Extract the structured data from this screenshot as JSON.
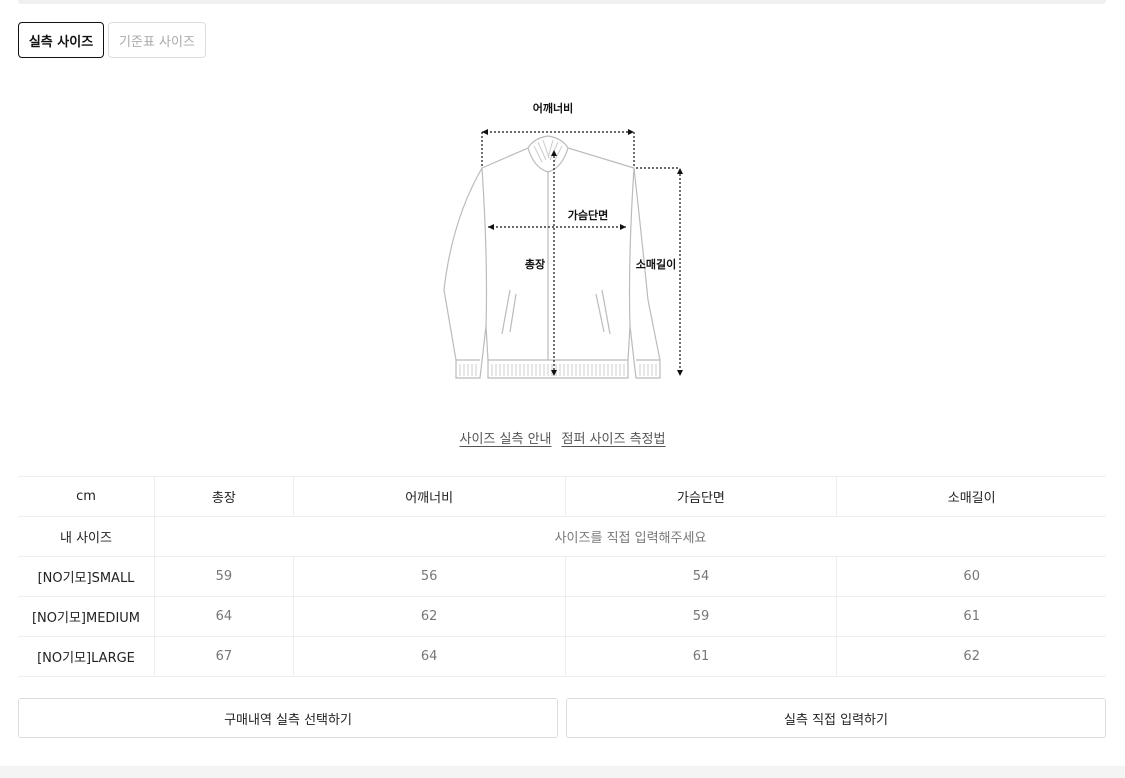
{
  "tabs": [
    {
      "label": "실측 사이즈",
      "active": true
    },
    {
      "label": "기준표 사이즈",
      "active": false
    }
  ],
  "diagram": {
    "labels": {
      "shoulder": "어깨너비",
      "chest": "가슴단면",
      "length": "총장",
      "sleeve": "소매길이"
    }
  },
  "guide_links": [
    "사이즈 실측 안내",
    "점퍼 사이즈 측정법"
  ],
  "table": {
    "unit": "cm",
    "columns": [
      "총장",
      "어깨너비",
      "가슴단면",
      "소매길이"
    ],
    "my_size_label": "내 사이즈",
    "my_size_placeholder": "사이즈를 직접 입력해주세요",
    "rows": [
      {
        "name": "[NO기모]SMALL",
        "values": [
          "59",
          "56",
          "54",
          "60"
        ]
      },
      {
        "name": "[NO기모]MEDIUM",
        "values": [
          "64",
          "62",
          "59",
          "61"
        ]
      },
      {
        "name": "[NO기모]LARGE",
        "values": [
          "67",
          "64",
          "61",
          "62"
        ]
      }
    ]
  },
  "actions": {
    "select_history": "구매내역 실측 선택하기",
    "direct_input": "실측 직접 입력하기"
  }
}
